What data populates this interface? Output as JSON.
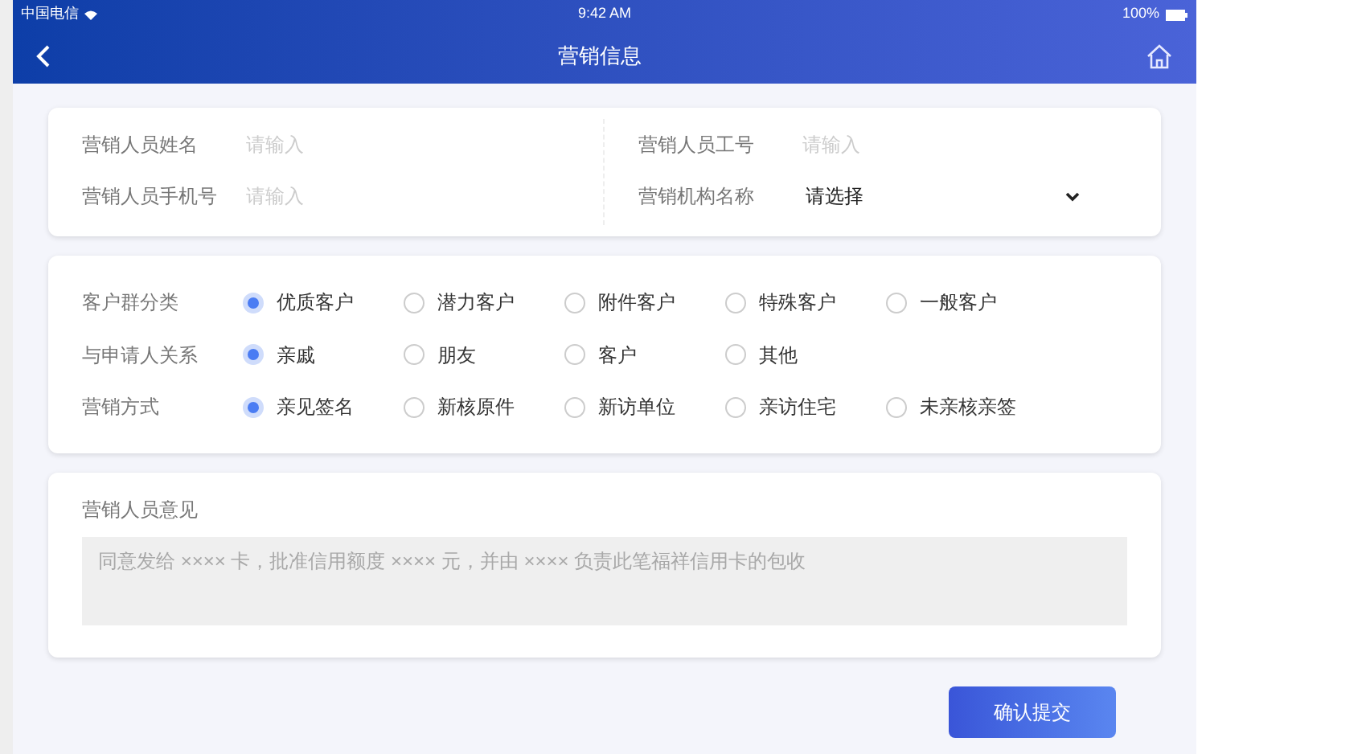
{
  "status_bar": {
    "carrier": "中国电信",
    "time": "9:42 AM",
    "battery": "100%"
  },
  "nav": {
    "title": "营销信息"
  },
  "staff": {
    "fields": [
      {
        "label": "营销人员姓名",
        "placeholder": "请输入"
      },
      {
        "label": "营销人员工号",
        "placeholder": "请输入"
      },
      {
        "label": "营销人员手机号",
        "placeholder": "请输入"
      },
      {
        "label": "营销机构名称",
        "value": "请选择",
        "kind": "select"
      }
    ]
  },
  "radio_groups": [
    {
      "label": "客户群分类",
      "options": [
        {
          "label": "优质客户",
          "selected": true
        },
        {
          "label": "潜力客户",
          "selected": false
        },
        {
          "label": "附件客户",
          "selected": false
        },
        {
          "label": "特殊客户",
          "selected": false
        },
        {
          "label": "一般客户",
          "selected": false
        }
      ]
    },
    {
      "label": "与申请人关系",
      "options": [
        {
          "label": "亲戚",
          "selected": true
        },
        {
          "label": "朋友",
          "selected": false
        },
        {
          "label": "客户",
          "selected": false
        },
        {
          "label": "其他",
          "selected": false
        }
      ]
    },
    {
      "label": "营销方式",
      "options": [
        {
          "label": "亲见签名",
          "selected": true
        },
        {
          "label": "新核原件",
          "selected": false
        },
        {
          "label": "新访单位",
          "selected": false
        },
        {
          "label": "亲访住宅",
          "selected": false
        },
        {
          "label": "未亲核亲签",
          "selected": false
        }
      ]
    }
  ],
  "opinion": {
    "label": "营销人员意见",
    "placeholder": "同意发给 ×××× 卡，批准信用额度 ×××× 元，并由 ×××× 负责此笔福祥信用卡的包收"
  },
  "submit": "确认提交"
}
